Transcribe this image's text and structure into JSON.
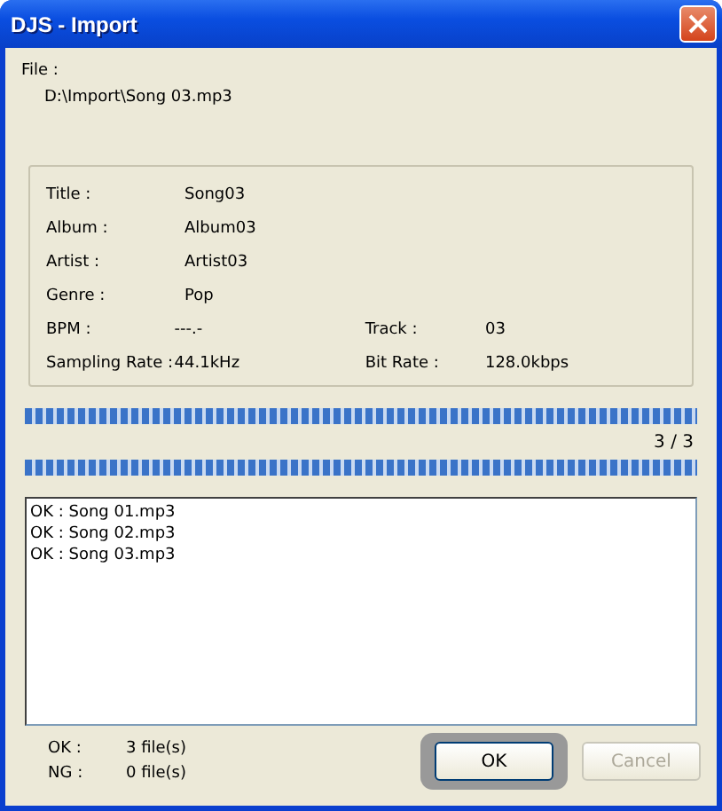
{
  "window": {
    "title": "DJS - Import"
  },
  "file": {
    "label": "File :",
    "path": "D:\\Import\\Song 03.mp3"
  },
  "info_rows": [
    {
      "fields": [
        {
          "label": "Title :",
          "value": "Song03"
        }
      ]
    },
    {
      "fields": [
        {
          "label": "Album :",
          "value": "Album03"
        }
      ]
    },
    {
      "fields": [
        {
          "label": "Artist :",
          "value": "Artist03"
        }
      ]
    },
    {
      "fields": [
        {
          "label": "Genre :",
          "value": "Pop"
        }
      ]
    },
    {
      "fields": [
        {
          "label": "BPM :",
          "value": "---.-"
        },
        {
          "label": "Track :",
          "value": "03"
        }
      ]
    },
    {
      "fields": [
        {
          "label": "Sampling Rate :",
          "value": "44.1kHz"
        },
        {
          "label": "Bit Rate :",
          "value": "128.0kbps"
        }
      ]
    }
  ],
  "file_progress": {
    "level": 1
  },
  "count": "3 / 3",
  "total_progress": {
    "level": 1
  },
  "log": [
    "OK : Song 01.mp3",
    "OK : Song 02.mp3",
    "OK : Song 03.mp3"
  ],
  "summary": [
    {
      "label": "OK :",
      "value": "3 file(s)"
    },
    {
      "label": "NG :",
      "value": "0 file(s)"
    }
  ],
  "buttons": [
    {
      "label": "OK",
      "disabled": false,
      "highlighted": true
    },
    {
      "label": "Cancel",
      "disabled": true,
      "highlighted": false
    }
  ]
}
